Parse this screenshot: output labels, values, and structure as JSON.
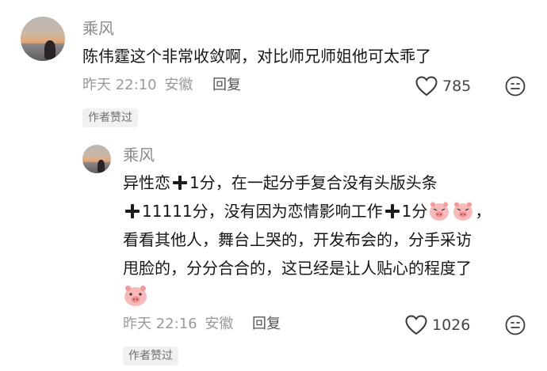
{
  "comments": [
    {
      "username": "乘风",
      "text": "陈伟霆这个非常收敛啊，对比师兄师姐他可太乖了",
      "time": "昨天 22:10",
      "location": "安徽",
      "reply_label": "回复",
      "like_count": "785",
      "badge": "作者赞过"
    },
    {
      "username": "乘风",
      "lines": [
        [
          "异性恋",
          "1分，在一起分手复合没有头版头条"
        ],
        [
          "11111分，没有因为恋情影响工作",
          "1分",
          "，"
        ],
        [
          "看看其他人，舞台上哭的，开发布会的，分手采访"
        ],
        [
          "甩脸的，分分合合的，这已经是让人贴心的程度了"
        ]
      ],
      "time": "昨天 22:16",
      "location": "安徽",
      "reply_label": "回复",
      "like_count": "1026",
      "badge": "作者赞过"
    }
  ],
  "icons": {
    "like": "heart-outline-icon",
    "emoji": "emoji-face-icon",
    "plus": "heavy-plus-emoji",
    "pig": "pig-face-emoji"
  },
  "colors": {
    "username": "#8a8a8a",
    "text": "#161616",
    "meta": "#9a9a9a",
    "badge_bg": "#f1f1f1",
    "pig": "#f7b4b4"
  }
}
